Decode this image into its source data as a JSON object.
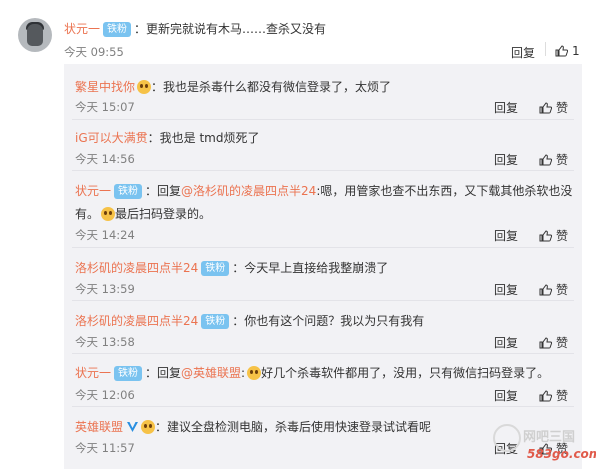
{
  "main_comment": {
    "username": "状元一",
    "badge": "铁粉",
    "text": "：更新完就说有木马……查杀又没有",
    "time": "今天 09:55",
    "reply_label": "回复",
    "like_count": "1"
  },
  "replies": [
    {
      "username": "繁星中找你",
      "has_emoji_badge": true,
      "text": "：我也是杀毒什么都没有微信登录了，太烦了",
      "time": "今天 15:07",
      "reply_label": "回复",
      "like_label": "赞"
    },
    {
      "username": "iG可以大满贯",
      "text": "：我也是 tmd烦死了",
      "time": "今天 14:56",
      "reply_label": "回复",
      "like_label": "赞"
    },
    {
      "username": "状元一",
      "badge": "铁粉",
      "prefix": "：回复",
      "mention": "@洛杉矶的凌晨四点半24",
      "text_line1": ":嗯，用管家也查不出东西，又下载其他杀软也没",
      "text_line2": "有。",
      "text_line2_after": "最后扫码登录的。",
      "time": "今天 14:24",
      "reply_label": "回复",
      "like_label": "赞"
    },
    {
      "username": "洛杉矶的凌晨四点半24",
      "badge": "铁粉",
      "text": "：今天早上直接给我整崩溃了",
      "time": "今天 13:59",
      "reply_label": "回复",
      "like_label": "赞"
    },
    {
      "username": "洛杉矶的凌晨四点半24",
      "badge": "铁粉",
      "text": "：你也有这个问题？我以为只有我有",
      "time": "今天 13:58",
      "reply_label": "回复",
      "like_label": "赞"
    },
    {
      "username": "状元一",
      "badge": "铁粉",
      "prefix": "：回复",
      "mention": "@英雄联盟",
      "text": "好几个杀毒软件都用了，没用，只有微信扫码登录了。",
      "time": "今天 12:06",
      "reply_label": "回复",
      "like_label": "赞"
    },
    {
      "username": "英雄联盟",
      "verified": true,
      "text": "：建议全盘检测电脑，杀毒后使用快速登录试试看呢",
      "time": "今天 11:57",
      "reply_label": "回复",
      "like_label": "赞"
    }
  ],
  "watermark": {
    "text": "网吧三国",
    "url": "583go.com"
  },
  "colors": {
    "username": "#eb7350",
    "badge": "#7ac3f0",
    "reply_bg": "#f2f2f5",
    "time": "#808080"
  }
}
